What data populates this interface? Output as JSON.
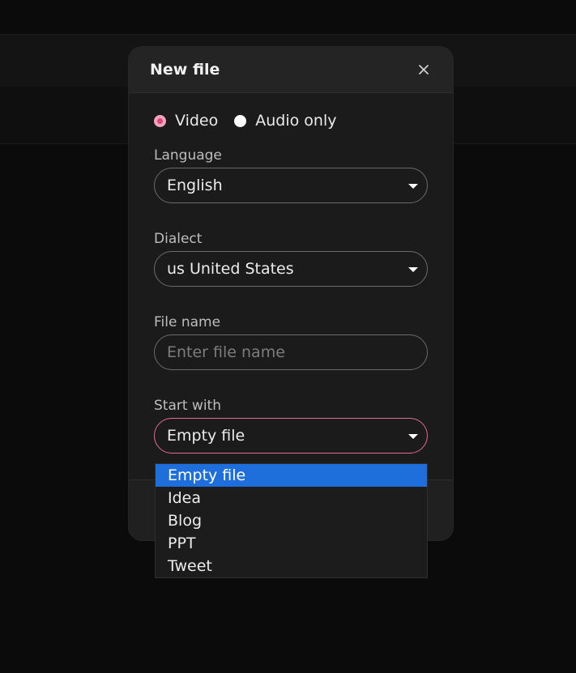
{
  "modal": {
    "title": "New file",
    "close_icon": "close-icon"
  },
  "media_type": {
    "options": [
      {
        "label": "Video",
        "checked": true
      },
      {
        "label": "Audio only",
        "checked": false
      }
    ]
  },
  "language": {
    "label": "Language",
    "value": "English"
  },
  "dialect": {
    "label": "Dialect",
    "value": "us United States"
  },
  "file_name": {
    "label": "File name",
    "placeholder": "Enter file name",
    "value": ""
  },
  "start_with": {
    "label": "Start with",
    "value": "Empty file",
    "options": [
      "Empty file",
      "Idea",
      "Blog",
      "PPT",
      "Tweet"
    ],
    "selected_index": 0
  },
  "colors": {
    "accent": "#e36b93",
    "radio_checked": "#d9487a",
    "dropdown_highlight": "#1e6fdb",
    "background": "#0b0b0b",
    "modal": "#1b1b1c"
  }
}
